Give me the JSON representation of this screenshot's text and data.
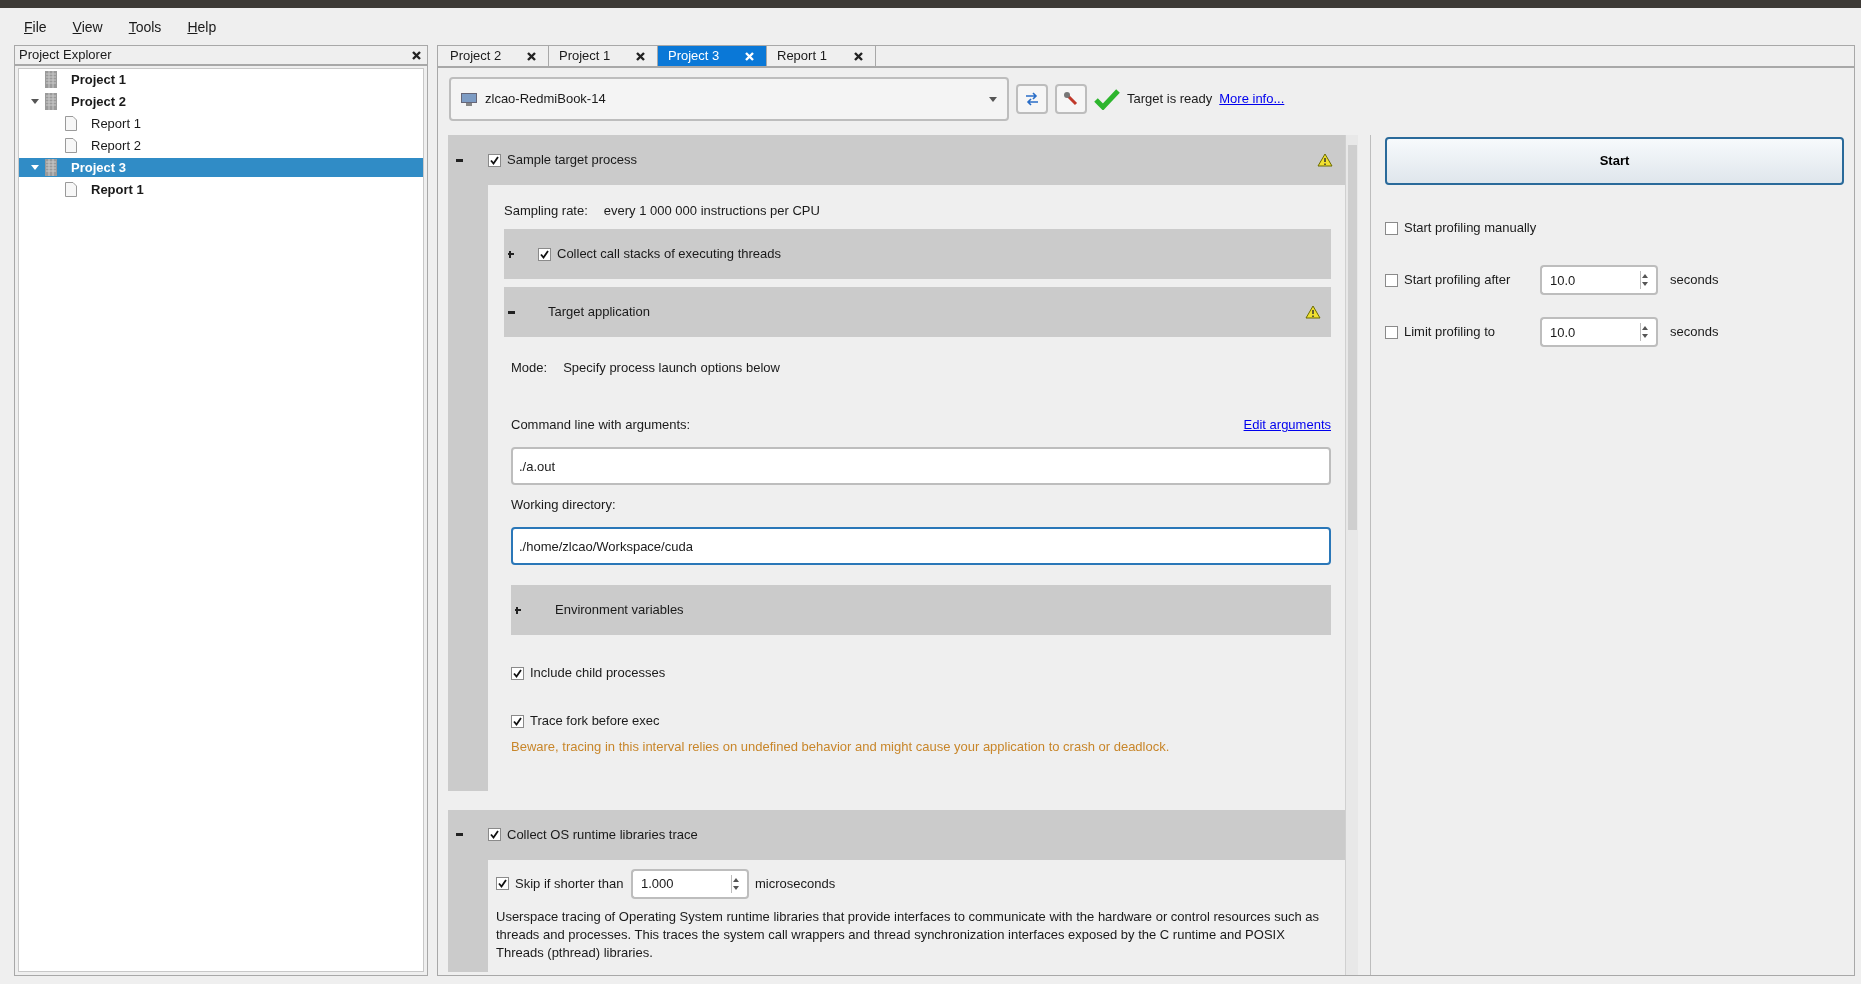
{
  "menu": [
    "File",
    "View",
    "Tools",
    "Help"
  ],
  "project_explorer": {
    "title": "Project Explorer",
    "tree": [
      {
        "label": "Project 1",
        "open": true,
        "selected": false
      },
      {
        "label": "Project 2",
        "open": true,
        "selected": false,
        "expanded": true,
        "children": [
          {
            "label": "Report 1",
            "open": false,
            "selected": false
          },
          {
            "label": "Report 2",
            "open": false,
            "selected": false
          }
        ]
      },
      {
        "label": "Project 3",
        "open": true,
        "selected": true,
        "expanded": true,
        "children": [
          {
            "label": "Report 1",
            "open": true,
            "selected": false
          }
        ]
      }
    ]
  },
  "tabs": [
    {
      "label": "Project 2",
      "selected": false
    },
    {
      "label": "Project 1",
      "selected": false
    },
    {
      "label": "Project 3",
      "selected": true
    },
    {
      "label": "Report 1",
      "selected": false
    }
  ],
  "target": {
    "machine": "zlcao-RedmiBook-14",
    "status": "Target is ready",
    "link": "More info..."
  },
  "sections": [
    {
      "title": "Sample target process",
      "checked": true,
      "expanded": true,
      "warning": true,
      "items": [
        {
          "kind": "field_row",
          "label": "Sampling rate:",
          "value": "every 1 000 000 instructions per CPU"
        },
        {
          "kind": "subsection",
          "title": "Collect call stacks of executing threads",
          "checked": true,
          "expanded": false,
          "warning": false
        },
        {
          "kind": "subsection",
          "title": "Target application",
          "expanded": true,
          "warning": true,
          "items": [
            {
              "kind": "field_row",
              "label": "Mode:",
              "value": "Specify process launch options below"
            },
            {
              "kind": "label_link",
              "label": "Command line with arguments:",
              "link": "Edit arguments"
            },
            {
              "kind": "text_field",
              "value": "./a.out",
              "focused": false
            },
            {
              "kind": "label",
              "label": "Working directory:"
            },
            {
              "kind": "text_field",
              "value": "./home/zlcao/Workspace/cuda",
              "focused": true
            },
            {
              "kind": "subsection",
              "title": "Environment variables",
              "expanded": false,
              "warning": false
            },
            {
              "kind": "checkbox",
              "label": "Include child processes",
              "checked": true
            },
            {
              "kind": "checkbox",
              "label": "Trace fork before exec",
              "checked": true
            },
            {
              "kind": "warning_text",
              "text": "Beware, tracing in this interval relies on undefined behavior and might cause your application to crash or deadlock."
            }
          ]
        }
      ]
    },
    {
      "title": "Collect OS runtime libraries trace",
      "checked": true,
      "expanded": true,
      "warning": false,
      "items": [
        {
          "kind": "spin_row",
          "label": "Skip if shorter than",
          "checked": true,
          "value": "1.000",
          "unit": "microseconds"
        },
        {
          "kind": "paragraph",
          "text": "Userspace tracing of Operating System runtime libraries that provide interfaces to communicate with the hardware or control resources such as threads and processes. This traces the system call wrappers and thread synchronization interfaces exposed by the C runtime and POSIX Threads (pthread) libraries."
        }
      ]
    }
  ],
  "start_button": "Start",
  "options": [
    {
      "kind": "checkbox",
      "label": "Start profiling manually",
      "checked": false
    },
    {
      "kind": "spin_row",
      "label": "Start profiling after",
      "checked": false,
      "value": "10.0",
      "unit": "seconds"
    },
    {
      "kind": "spin_row",
      "label": "Limit profiling to",
      "checked": false,
      "value": "10.0",
      "unit": "seconds"
    }
  ]
}
